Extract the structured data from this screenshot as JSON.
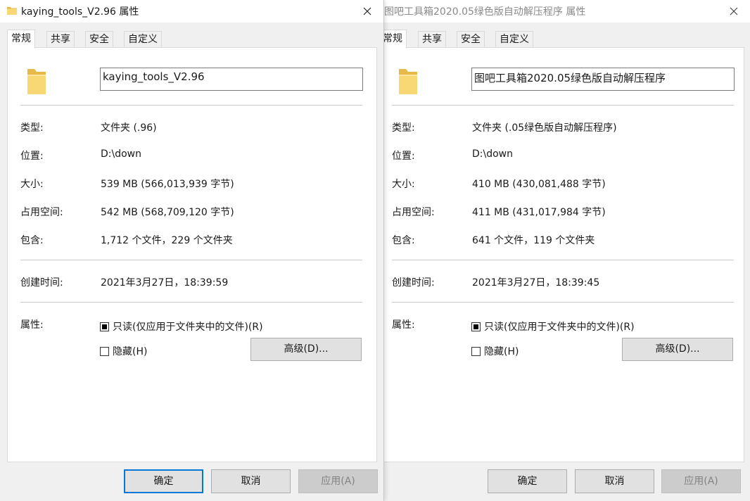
{
  "dialogs": [
    {
      "title": "kaying_tools_V2.96 属性",
      "tabs": [
        "常规",
        "共享",
        "安全",
        "自定义"
      ],
      "name": "kaying_tools_V2.96",
      "type_label": "类型:",
      "type_value": "文件夹 (.96)",
      "location_label": "位置:",
      "location_value": "D:\\down",
      "size_label": "大小:",
      "size_value": "539 MB (566,013,939 字节)",
      "disk_label": "占用空间:",
      "disk_value": "542 MB (568,709,120 字节)",
      "contains_label": "包含:",
      "contains_value": "1,712 个文件，229 个文件夹",
      "created_label": "创建时间:",
      "created_value": "2021年3月27日，18:39:59",
      "attr_label": "属性:",
      "readonly_label": "只读(仅应用于文件夹中的文件)(R)",
      "hidden_label": "隐藏(H)",
      "advanced_label": "高级(D)...",
      "ok_label": "确定",
      "cancel_label": "取消",
      "apply_label": "应用(A)"
    },
    {
      "title": "图吧工具箱2020.05绿色版自动解压程序 属性",
      "tabs": [
        "常规",
        "共享",
        "安全",
        "自定义"
      ],
      "name": "图吧工具箱2020.05绿色版自动解压程序",
      "type_label": "类型:",
      "type_value": "文件夹 (.05绿色版自动解压程序)",
      "location_label": "位置:",
      "location_value": "D:\\down",
      "size_label": "大小:",
      "size_value": "410 MB (430,081,488 字节)",
      "disk_label": "占用空间:",
      "disk_value": "411 MB (431,017,984 字节)",
      "contains_label": "包含:",
      "contains_value": "641 个文件，119 个文件夹",
      "created_label": "创建时间:",
      "created_value": "2021年3月27日，18:39:45",
      "attr_label": "属性:",
      "readonly_label": "只读(仅应用于文件夹中的文件)(R)",
      "hidden_label": "隐藏(H)",
      "advanced_label": "高级(D)...",
      "ok_label": "确定",
      "cancel_label": "取消",
      "apply_label": "应用(A)"
    }
  ],
  "colors": {
    "window_bg": "#f0f0f0",
    "panel_bg": "#ffffff",
    "accent": "#0078d7",
    "folder_yellow": "#f8d775"
  },
  "icons": [
    "folder-icon",
    "close-icon"
  ]
}
